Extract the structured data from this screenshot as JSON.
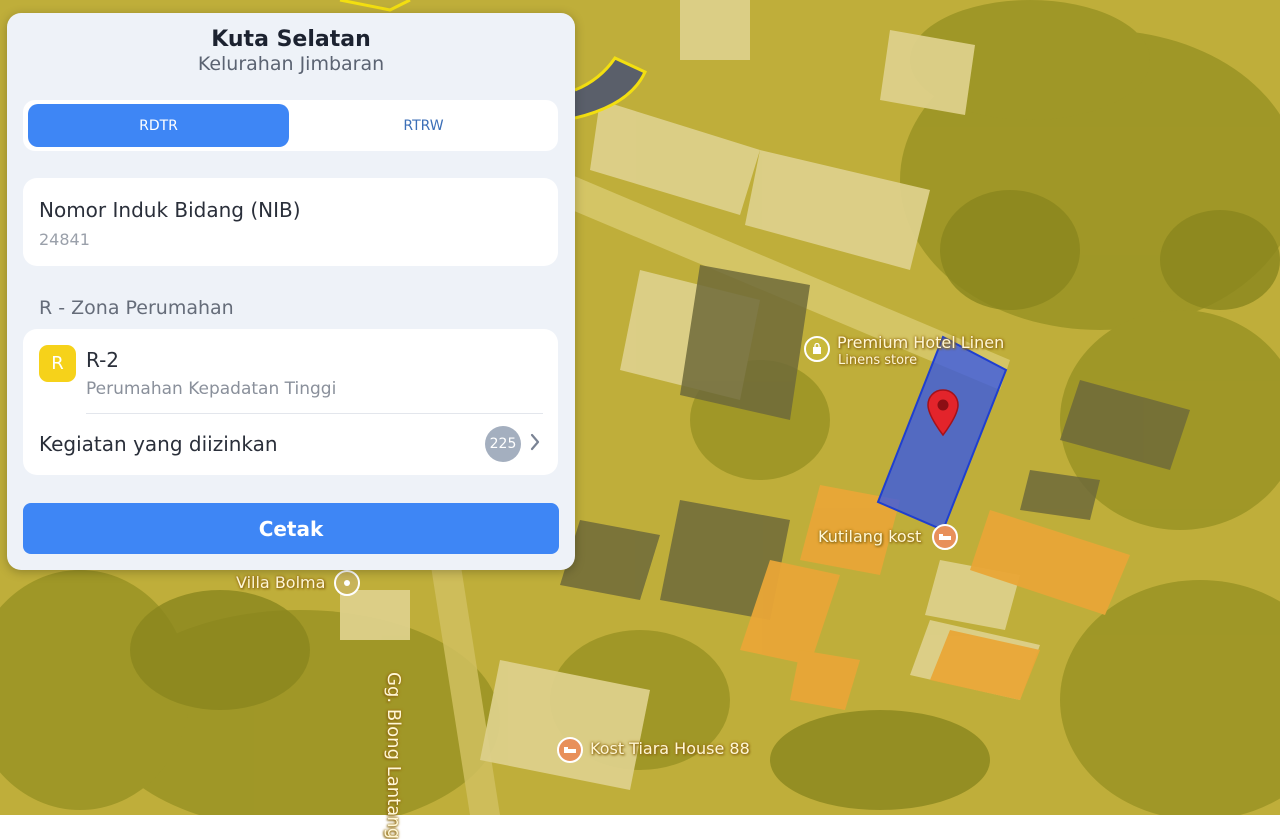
{
  "panel": {
    "title": "Kuta Selatan",
    "subtitle": "Kelurahan Jimbaran",
    "tabs": [
      {
        "label": "RDTR",
        "active": true
      },
      {
        "label": "RTRW",
        "active": false
      }
    ],
    "nib": {
      "label": "Nomor Induk Bidang (NIB)",
      "value": "24841"
    },
    "zone": {
      "heading": "R - Zona Perumahan",
      "badge": "R",
      "badge_color": "#f6d21a",
      "code": "R-2",
      "description": "Perumahan Kepadatan Tinggi"
    },
    "activities": {
      "label": "Kegiatan yang diizinkan",
      "count": "225"
    },
    "print_label": "Cetak"
  },
  "map": {
    "overlay_color": "#e8d23a",
    "parcel_color": "#3557e8",
    "places": {
      "premium": {
        "name": "Premium Hotel Linen",
        "category": "Linens store",
        "icon": "shopping-bag-icon"
      },
      "kutilang": {
        "name": "Kutilang kost",
        "icon": "bed-icon"
      },
      "villa": {
        "name": "Villa Bolma",
        "icon": "place-pin-icon"
      },
      "kost_tiara": {
        "name": "Kost Tiara House 88",
        "icon": "bed-icon"
      }
    },
    "street": "Gg. Blong Lantang",
    "pin_icon": "location-pin-icon"
  }
}
